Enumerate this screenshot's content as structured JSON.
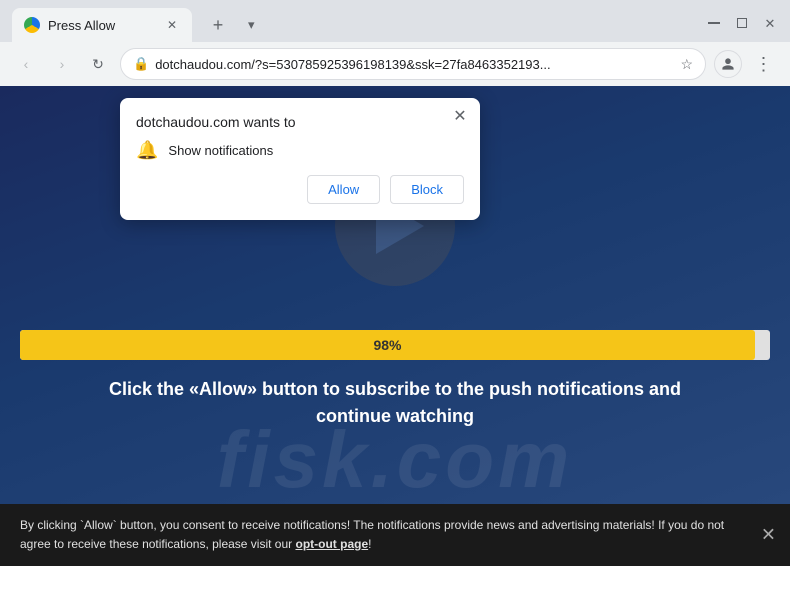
{
  "browser": {
    "tab": {
      "title": "Press Allow",
      "favicon_alt": "site-favicon"
    },
    "new_tab_btn": "+",
    "window_controls": {
      "minimize": "—",
      "maximize": "⬜",
      "close": "✕"
    },
    "address_bar": {
      "url": "dotchaudou.com/?s=530785925396198139&ssk=27fa8463352193...",
      "lock_icon": "🔒"
    },
    "nav": {
      "back": "‹",
      "forward": "›",
      "refresh": "↻"
    }
  },
  "notification_popup": {
    "title": "dotchaudou.com wants to",
    "permission_label": "Show notifications",
    "allow_btn": "Allow",
    "block_btn": "Block",
    "close_icon": "✕"
  },
  "page": {
    "progress_percent": "98%",
    "instruction_text": "Click the «Allow» button to subscribe to the push notifications and continue watching",
    "watermark": "fisk.com"
  },
  "bottom_banner": {
    "text_before_link": "By clicking `Allow` button, you consent to receive notifications! The notifications provide news and advertising materials! If you do not agree to receive these notifications, please visit our ",
    "link_text": "opt-out page",
    "text_after_link": "!",
    "close_icon": "✕"
  }
}
